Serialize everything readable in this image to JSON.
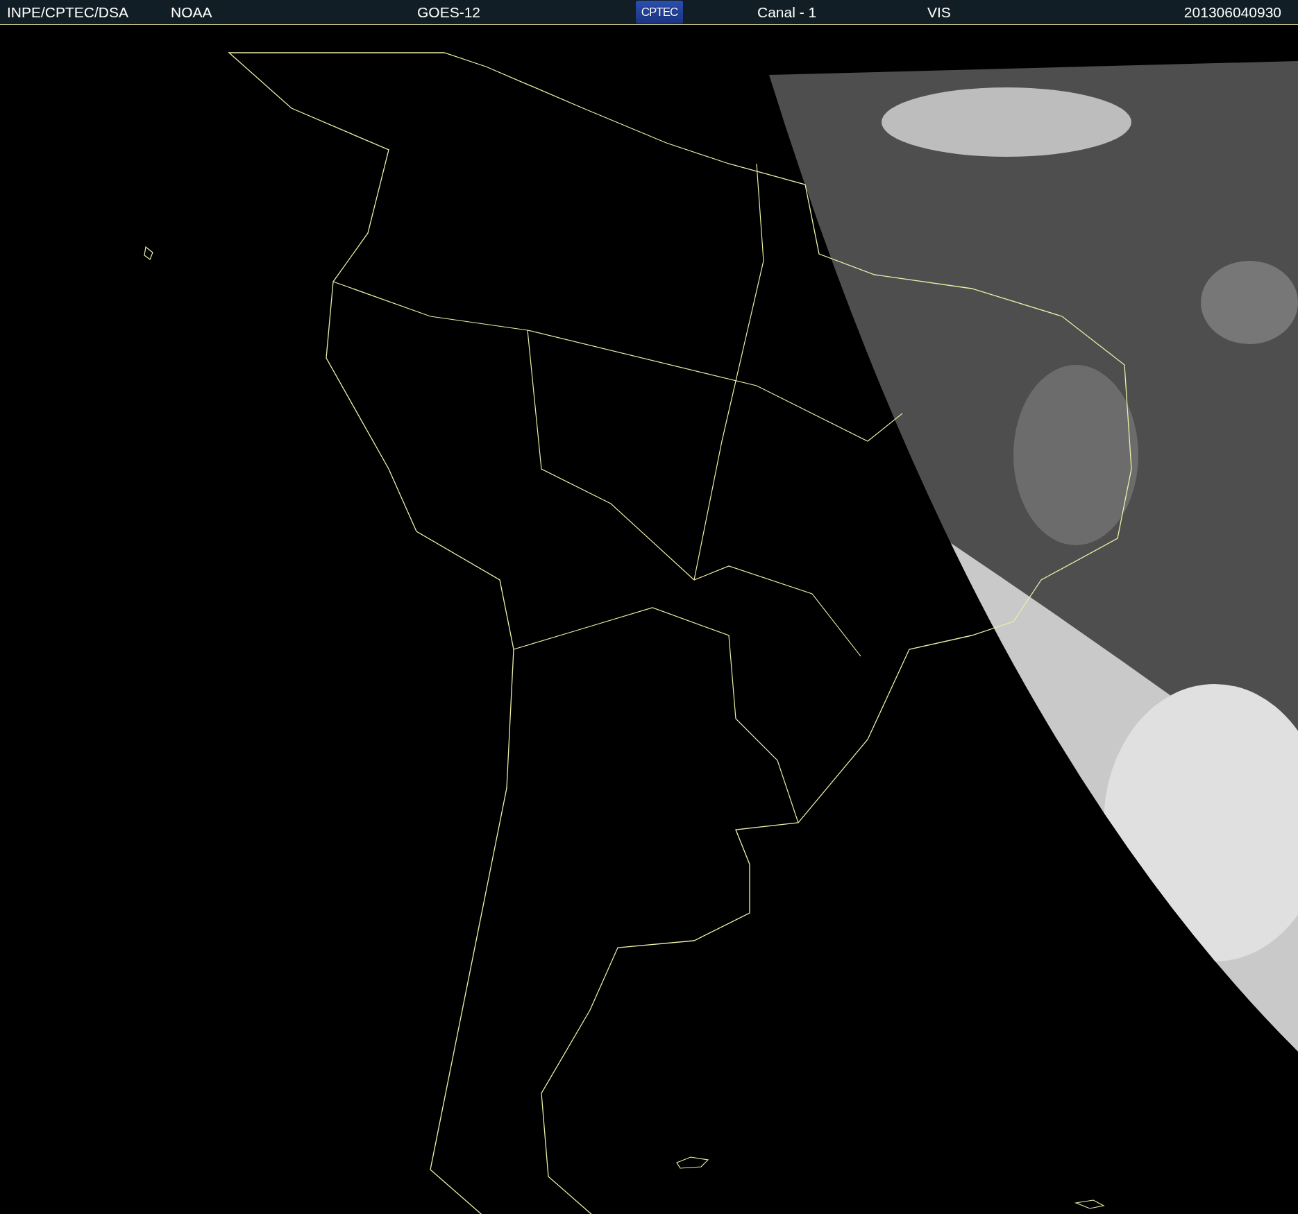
{
  "header": {
    "items": [
      {
        "kind": "text",
        "text": "INPE/CPTEC/DSA"
      },
      {
        "kind": "text",
        "text": "NOAA"
      },
      {
        "kind": "text",
        "text": "GOES-12"
      },
      {
        "kind": "logo",
        "text": "CPTEC"
      },
      {
        "kind": "text",
        "text": "Canal - 1"
      },
      {
        "kind": "text",
        "text": "VIS"
      },
      {
        "kind": "text",
        "text": "201306040930"
      }
    ]
  }
}
